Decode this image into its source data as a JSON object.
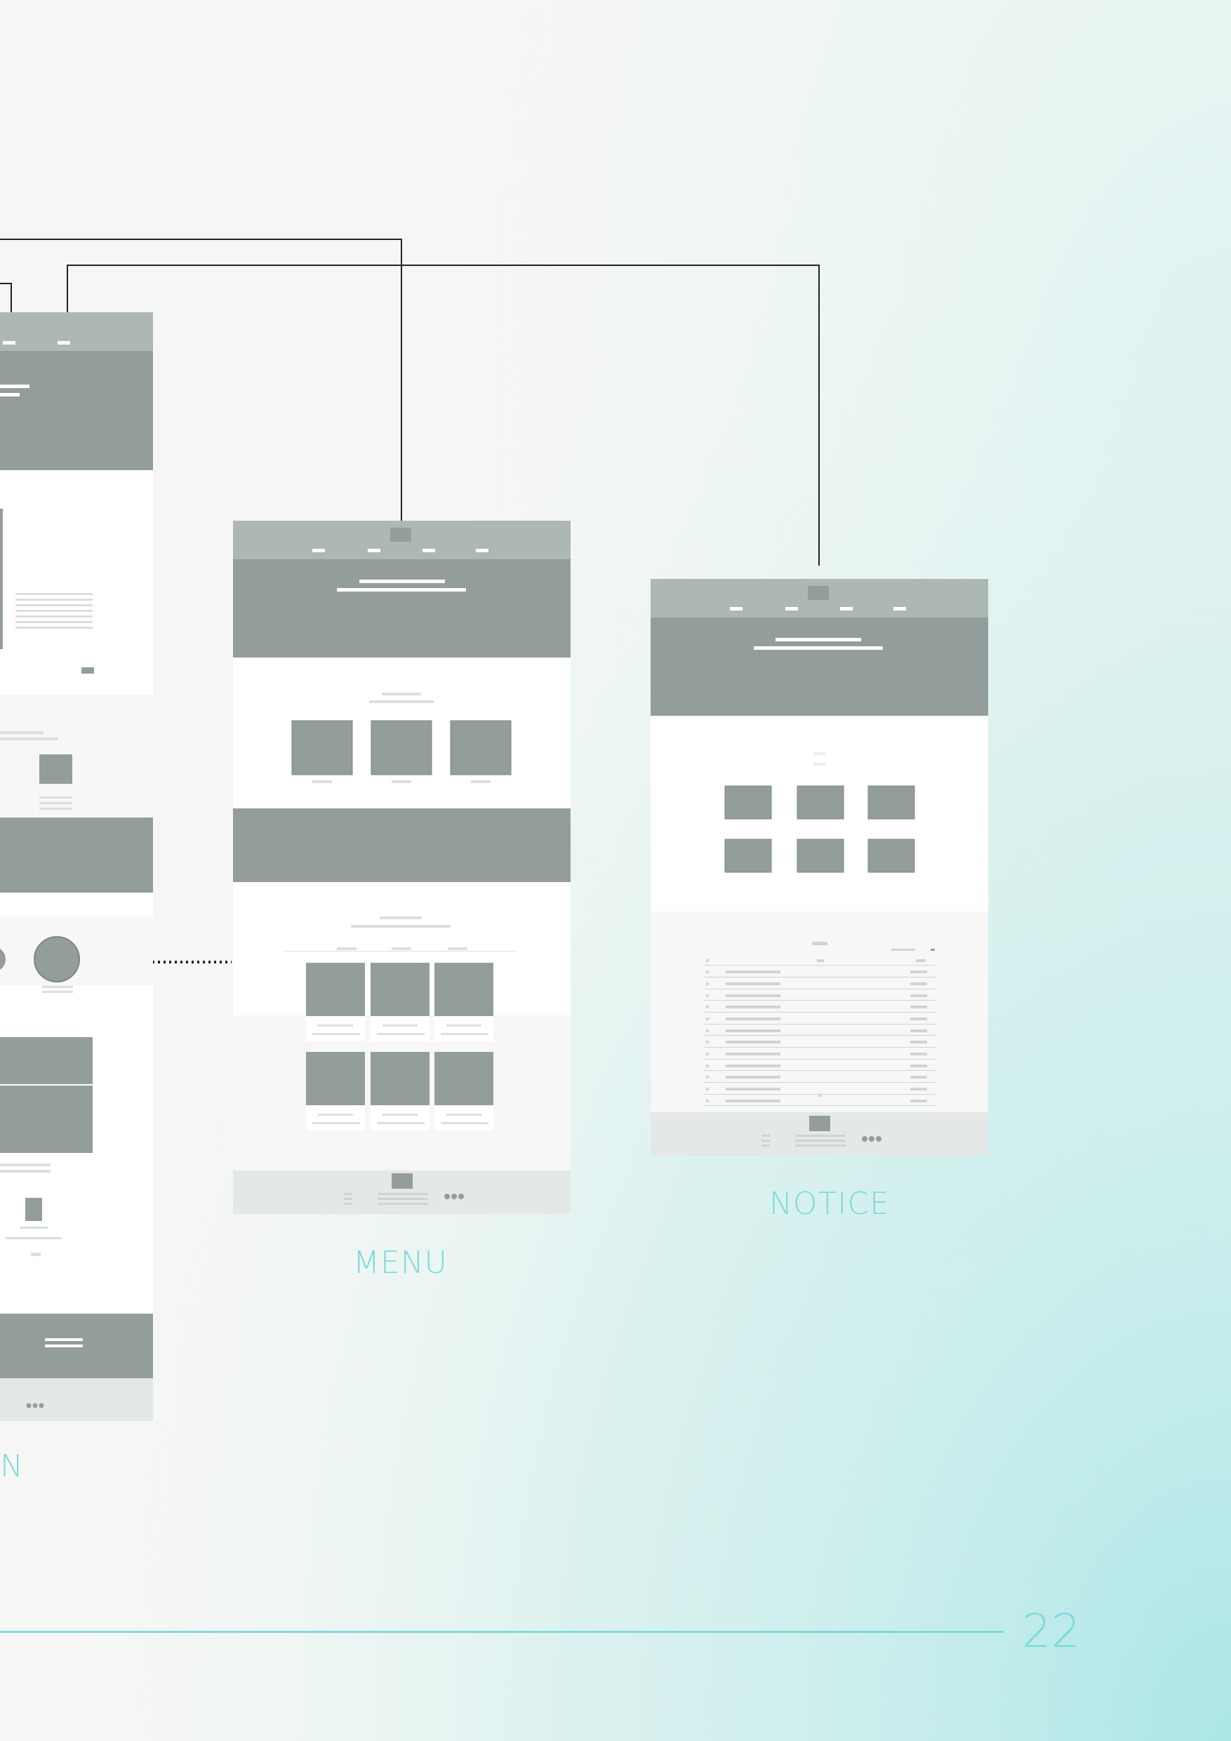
{
  "labels": {
    "left": "N",
    "menu": "MENU",
    "notice": "NOTICE"
  },
  "page_number": "22",
  "colors": {
    "accent": "#7fdada",
    "wire_dark": "#939e9c",
    "wire_header": "#adb7b4",
    "wire_light": "#d9dddc",
    "wire_footer": "#e4e8e7",
    "panel": "#ffffff",
    "panel_alt": "#f6f7f6",
    "connector": "#222222"
  },
  "icons": [
    "more-dots-icon"
  ]
}
